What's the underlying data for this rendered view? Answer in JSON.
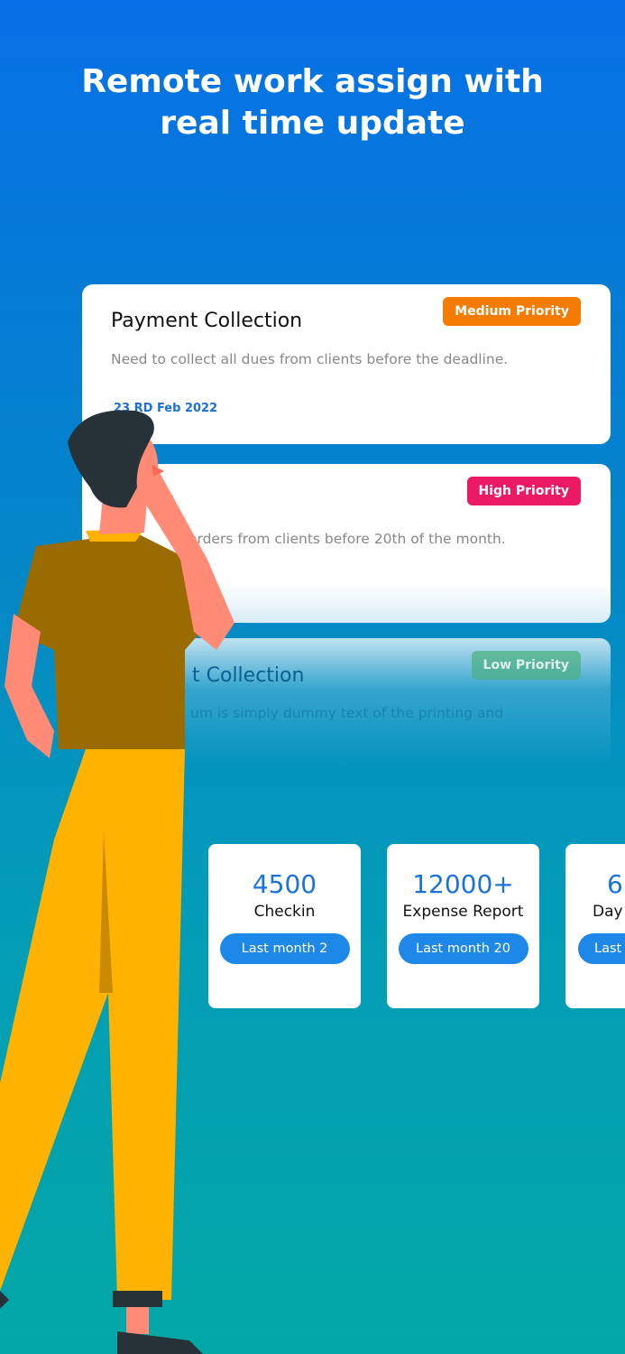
{
  "headline": "Remote work assign with real time update",
  "tasks": [
    {
      "title": "Payment Collection",
      "description": "Need to collect all dues from clients before the deadline.",
      "priority": "Medium Priority",
      "priority_color": "#f57c00",
      "date": "23 RD Feb 2022"
    },
    {
      "title": "er",
      "description": "orders from clients before 20th of the month.",
      "priority": "High Priority",
      "priority_color": "#ec1a64"
    },
    {
      "title": "t Collection",
      "description": "um is simply dummy text of the printing and",
      "priority": "Low Priority",
      "priority_color": "#4caf80"
    }
  ],
  "stats": [
    {
      "value": "4500",
      "label": "Checkin",
      "button": "Last month 2"
    },
    {
      "value": "12000+",
      "label": "Expense Report",
      "button": "Last month 20"
    },
    {
      "value": "6",
      "label": "Day",
      "button": "Last"
    }
  ]
}
